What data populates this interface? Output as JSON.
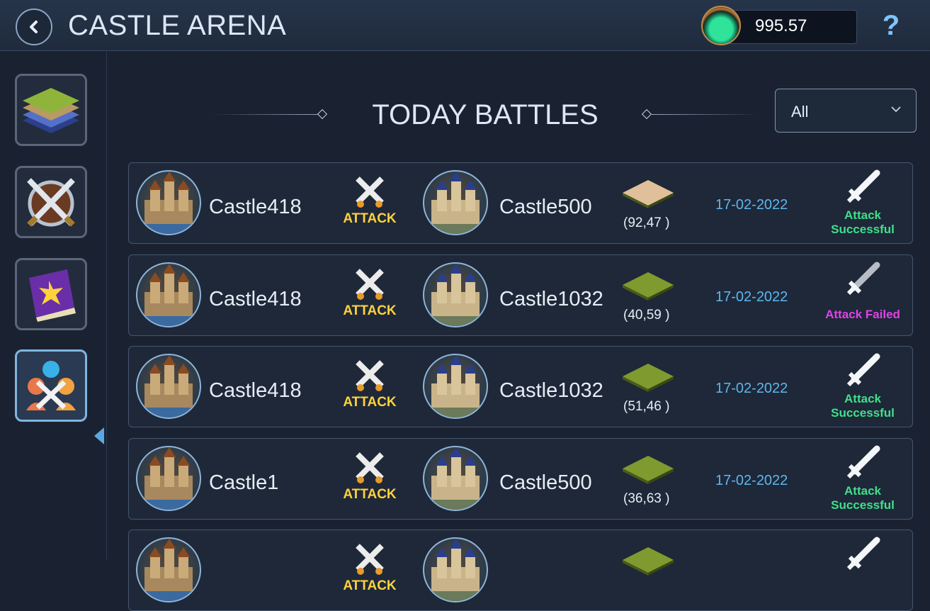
{
  "header": {
    "title": "CASTLE ARENA",
    "balance": "995.57",
    "help_label": "?"
  },
  "sidebar": {
    "items": [
      "map-layers",
      "battle-shield",
      "spell-book",
      "players-battle"
    ],
    "active_index": 3
  },
  "section": {
    "title": "TODAY BATTLES"
  },
  "filter": {
    "selected": "All"
  },
  "action_label": "ATTACK",
  "battles": [
    {
      "attacker": "Castle418",
      "defender": "Castle500",
      "coords": "(92,47 )",
      "tile": "#e0c09a",
      "date": "17-02-2022",
      "result": "Attack Successful",
      "status": "success"
    },
    {
      "attacker": "Castle418",
      "defender": "Castle1032",
      "coords": "(40,59 )",
      "tile": "#7f9a2e",
      "date": "17-02-2022",
      "result": "Attack Failed",
      "status": "failed"
    },
    {
      "attacker": "Castle418",
      "defender": "Castle1032",
      "coords": "(51,46 )",
      "tile": "#7f9a2e",
      "date": "17-02-2022",
      "result": "Attack Successful",
      "status": "success"
    },
    {
      "attacker": "Castle1",
      "defender": "Castle500",
      "coords": "(36,63 )",
      "tile": "#7f9a2e",
      "date": "17-02-2022",
      "result": "Attack Successful",
      "status": "success"
    },
    {
      "attacker": "",
      "defender": "",
      "coords": "",
      "tile": "#7f9a2e",
      "date": "",
      "result": "",
      "status": "success"
    }
  ]
}
